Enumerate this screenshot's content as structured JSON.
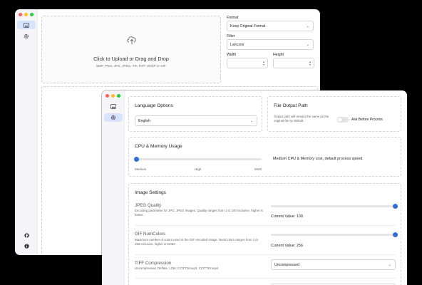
{
  "back_window": {
    "upload": {
      "title": "Click to Upload or Drag and Drop",
      "formats": "BMP, PNG, JPG, JPEG, TIF, TIFF, WebP or GIF"
    },
    "format": {
      "label": "Format",
      "value": "Keep Original Format"
    },
    "filter": {
      "label": "Filter",
      "value": "Lanczos"
    },
    "width": {
      "label": "Width",
      "value": ""
    },
    "height": {
      "label": "Height",
      "value": ""
    }
  },
  "settings_window": {
    "language": {
      "title": "Language Options",
      "value": "English"
    },
    "output": {
      "title": "File Output Path",
      "description": "Output path will remain the same as the original file by default.",
      "toggle_label": "Ask Before Process",
      "toggle_on": false
    },
    "cpu": {
      "title": "CPU & Memory Usage",
      "ticks": [
        "Medium",
        "High",
        "Most"
      ],
      "level": 0,
      "description": "Medium CPU & Memory cost, default process speed."
    },
    "image_settings": {
      "title": "Image Settings",
      "jpeg": {
        "title": "JPEG Quality",
        "description": "Encoding parameter for JPG, JPEG images. Quality ranges from 1 to 100 inclusive, higher is better.",
        "current": "Current Value: 100",
        "fraction": 1.0
      },
      "gif": {
        "title": "GIF NumColors",
        "description": "Maximum number of colors used in the GIF encoded image. NumColors ranges from 1 to 256 inclusive, higher is better.",
        "current": "Current Value: 256",
        "fraction": 1.0
      },
      "tiff": {
        "title": "TIFF Compression",
        "description": "Uncompressed, Deflate, LZW, CCITTGroup3, CCITTGroup4",
        "value": "Uncompressed"
      }
    }
  },
  "colors": {
    "accent": "#2f6fd6",
    "active_sidebar": "#d6e4ff"
  }
}
